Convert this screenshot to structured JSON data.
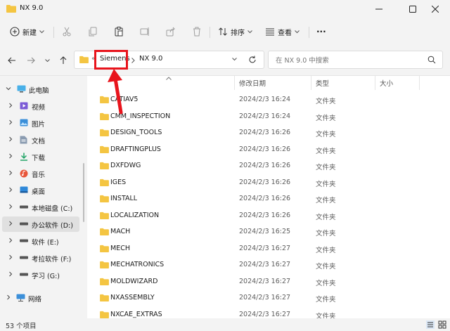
{
  "window": {
    "title": "NX 9.0"
  },
  "toolbar": {
    "new_label": "新建",
    "sort_label": "排序",
    "view_label": "查看",
    "more_label": "···"
  },
  "breadcrumb": {
    "overflow": "«",
    "items": [
      "Siemens",
      "NX 9.0"
    ]
  },
  "search": {
    "placeholder": "在 NX 9.0 中搜索"
  },
  "sidebar": {
    "items": [
      {
        "label": "此电脑",
        "icon": "pc-icon"
      },
      {
        "label": "视频",
        "icon": "video-icon"
      },
      {
        "label": "图片",
        "icon": "picture-icon"
      },
      {
        "label": "文档",
        "icon": "document-icon"
      },
      {
        "label": "下载",
        "icon": "download-icon"
      },
      {
        "label": "音乐",
        "icon": "music-icon"
      },
      {
        "label": "桌面",
        "icon": "desktop-icon"
      },
      {
        "label": "本地磁盘 (C:)",
        "icon": "drive-icon"
      },
      {
        "label": "办公软件 (D:)",
        "icon": "drive-icon"
      },
      {
        "label": "软件 (E:)",
        "icon": "drive-icon"
      },
      {
        "label": "考拉软件 (F:)",
        "icon": "drive-icon"
      },
      {
        "label": "学习 (G:)",
        "icon": "drive-icon"
      },
      {
        "label": "网络",
        "icon": "network-icon"
      }
    ]
  },
  "columns": {
    "name": "",
    "date": "修改日期",
    "type": "类型",
    "size": "大小"
  },
  "files": [
    {
      "name": "CATIAV5",
      "date": "2024/2/3 16:24",
      "type": "文件夹"
    },
    {
      "name": "CMM_INSPECTION",
      "date": "2024/2/3 16:24",
      "type": "文件夹"
    },
    {
      "name": "DESIGN_TOOLS",
      "date": "2024/2/3 16:26",
      "type": "文件夹"
    },
    {
      "name": "DRAFTINGPLUS",
      "date": "2024/2/3 16:26",
      "type": "文件夹"
    },
    {
      "name": "DXFDWG",
      "date": "2024/2/3 16:26",
      "type": "文件夹"
    },
    {
      "name": "IGES",
      "date": "2024/2/3 16:26",
      "type": "文件夹"
    },
    {
      "name": "INSTALL",
      "date": "2024/2/3 16:26",
      "type": "文件夹"
    },
    {
      "name": "LOCALIZATION",
      "date": "2024/2/3 16:26",
      "type": "文件夹"
    },
    {
      "name": "MACH",
      "date": "2024/2/3 16:25",
      "type": "文件夹"
    },
    {
      "name": "MECH",
      "date": "2024/2/3 16:27",
      "type": "文件夹"
    },
    {
      "name": "MECHATRONICS",
      "date": "2024/2/3 16:27",
      "type": "文件夹"
    },
    {
      "name": "MOLDWIZARD",
      "date": "2024/2/3 16:27",
      "type": "文件夹"
    },
    {
      "name": "NXASSEMBLY",
      "date": "2024/2/3 16:27",
      "type": "文件夹"
    },
    {
      "name": "NXCAE_EXTRAS",
      "date": "2024/2/3 16:27",
      "type": "文件夹"
    }
  ],
  "status": {
    "count": "53 个项目"
  },
  "colors": {
    "folder": "#f4c542",
    "annotation": "#e8141c"
  }
}
